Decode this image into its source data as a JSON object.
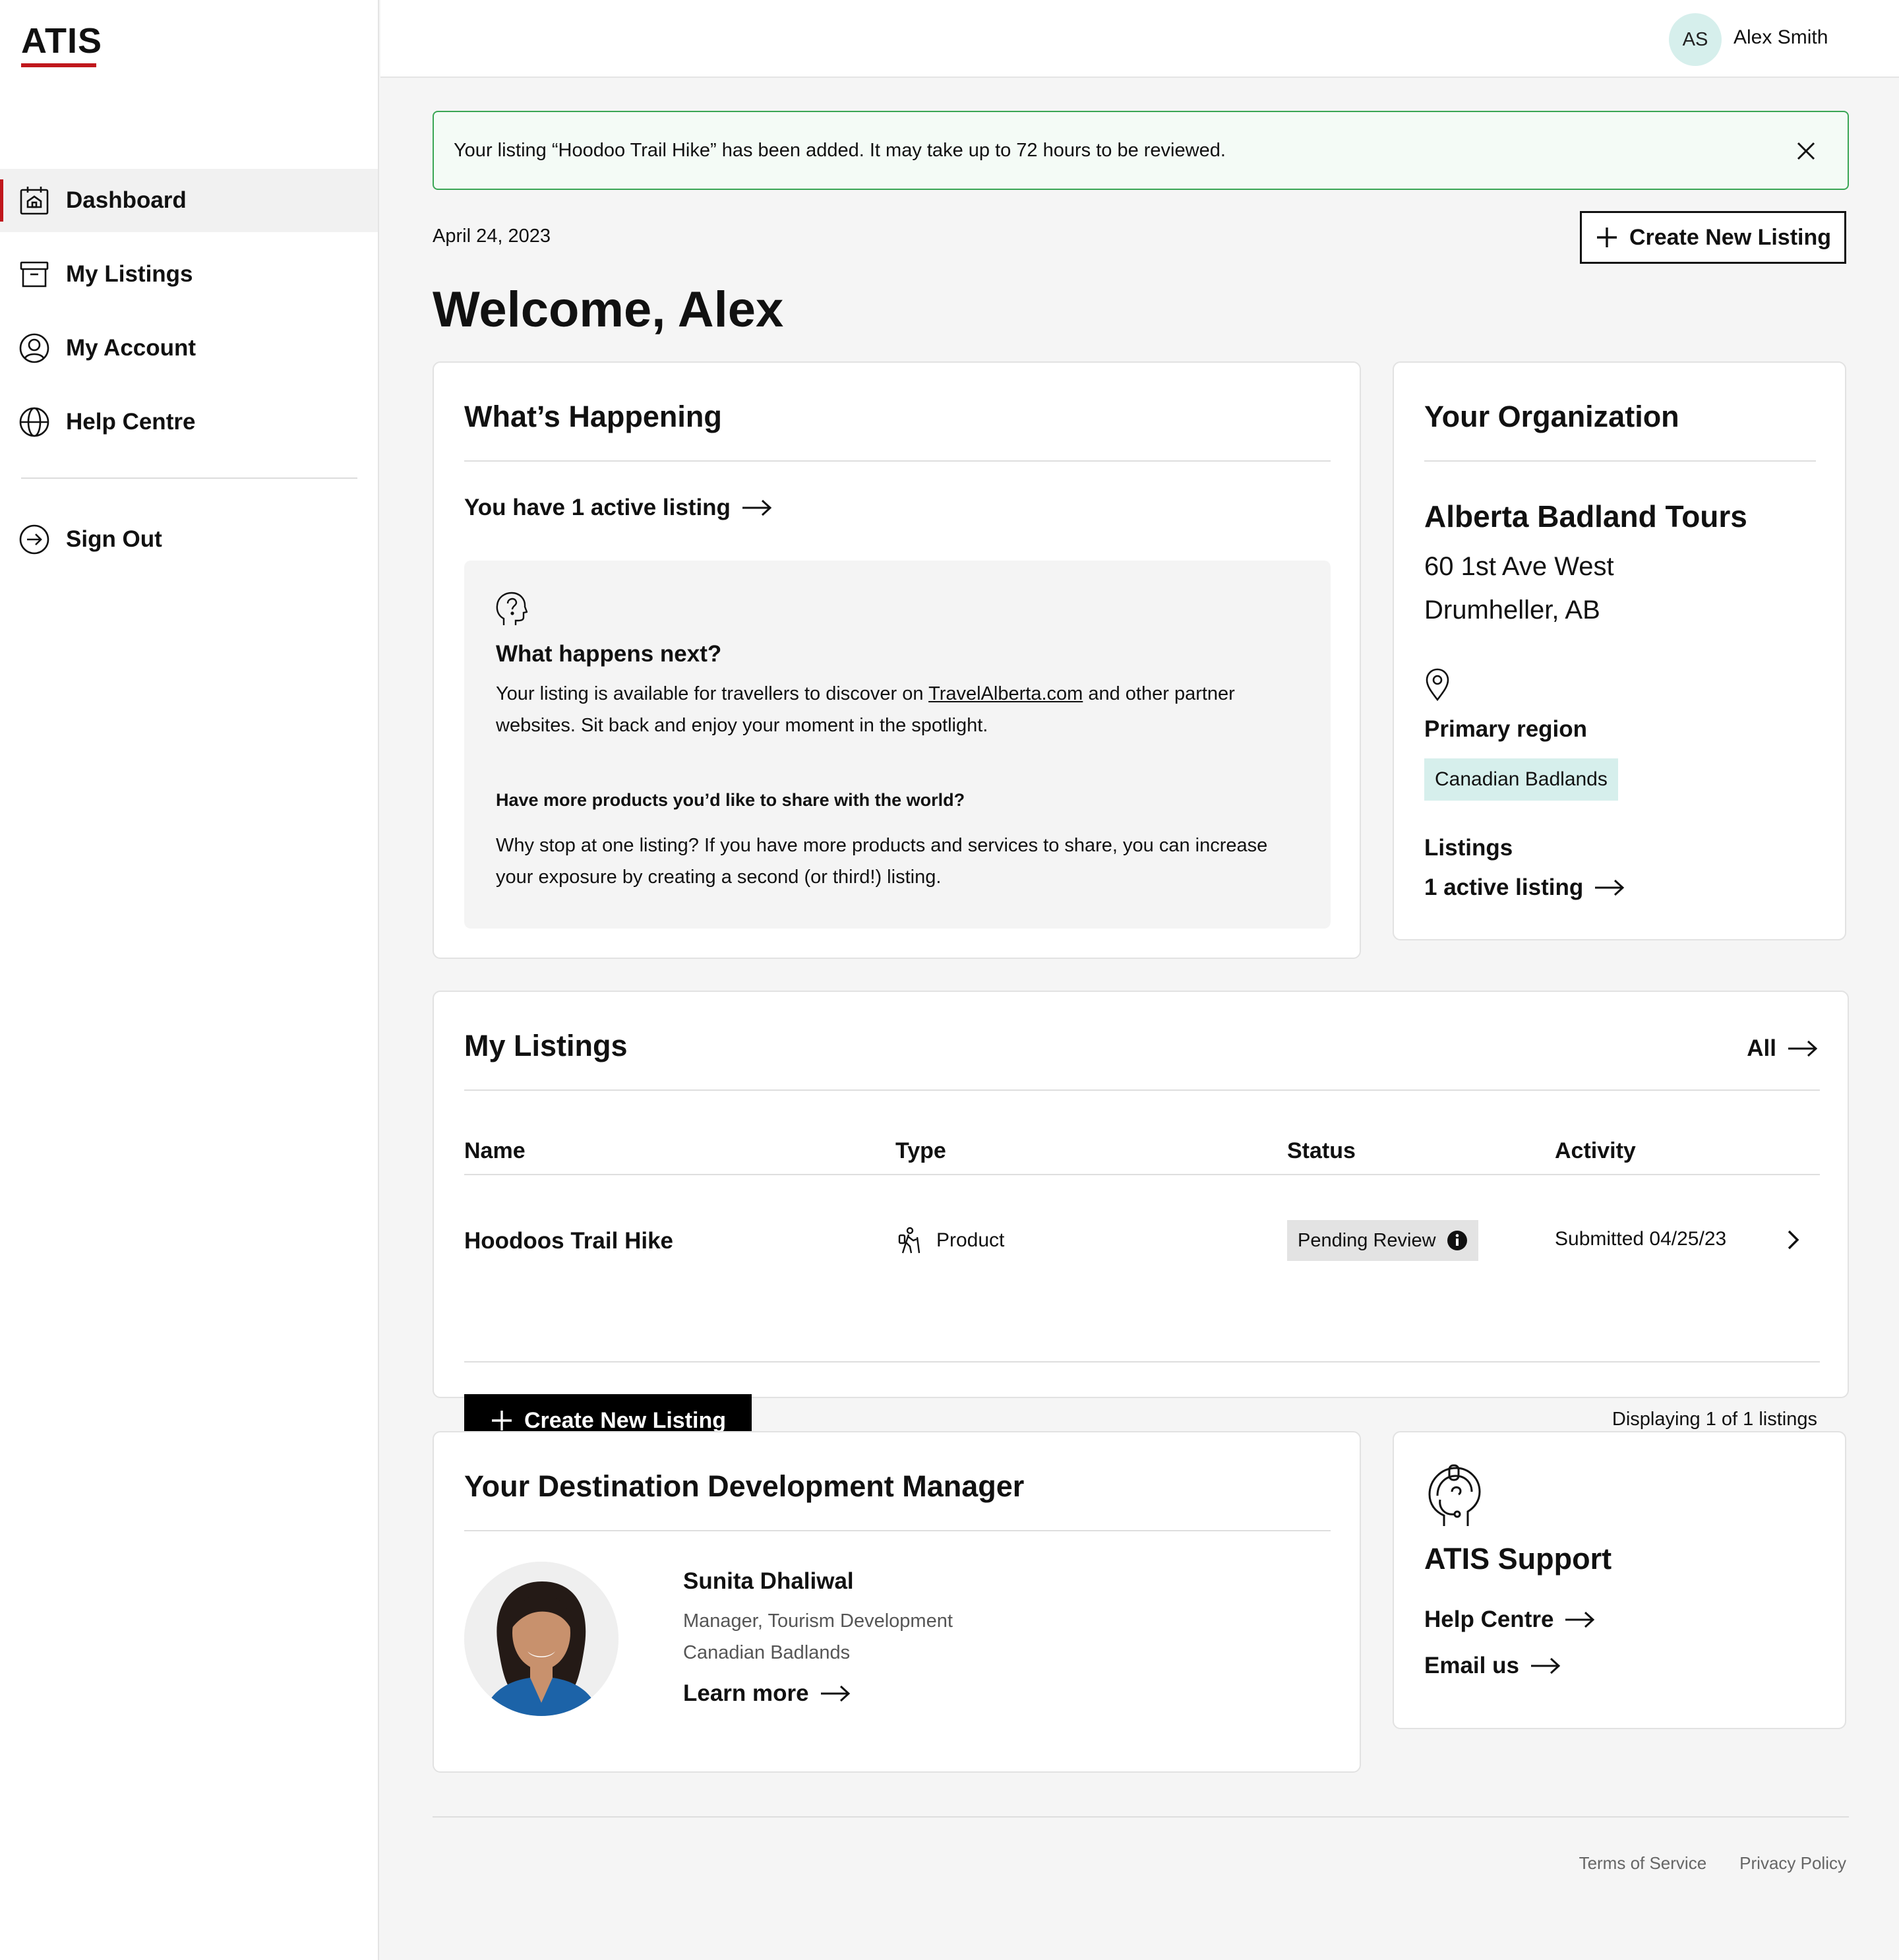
{
  "brand": {
    "logo_text": "ATIS",
    "accent": "#c0171c"
  },
  "sidebar": {
    "items": [
      {
        "label": "Dashboard",
        "icon": "home-calendar-icon",
        "active": true
      },
      {
        "label": "My Listings",
        "icon": "archive-box-icon",
        "active": false
      },
      {
        "label": "My Account",
        "icon": "user-circle-icon",
        "active": false
      },
      {
        "label": "Help Centre",
        "icon": "globe-icon",
        "active": false
      }
    ],
    "sign_out": {
      "label": "Sign Out",
      "icon": "sign-out-icon"
    }
  },
  "header": {
    "avatar_initials": "AS",
    "user_name": "Alex Smith"
  },
  "alert": {
    "message": "Your listing “Hoodoo Trail Hike” has been added. It may take up to 72 hours to be reviewed.",
    "color": "#3aa655"
  },
  "main": {
    "date": "April 24, 2023",
    "create_listing_label": "Create New Listing",
    "welcome": "Welcome, Alex"
  },
  "happening": {
    "title": "What’s Happening",
    "active_link": "You have 1 active listing",
    "next_title": "What happens next?",
    "next_text_before": "Your listing is available for travellers to discover on ",
    "next_link": "TravelAlberta.com",
    "next_text_after": " and other partner websites. Sit back and enjoy your moment in the spotlight.",
    "more_title": "Have more products you’d like to share with the world?",
    "more_text": "Why stop at one listing? If you have more products and services to share, you can increase your exposure by creating a second (or third!) listing."
  },
  "organization": {
    "title": "Your Organization",
    "name": "Alberta Badland Tours",
    "address_line1": "60 1st Ave West",
    "address_line2": "Drumheller, AB",
    "region_label": "Primary region",
    "region": "Canadian Badlands",
    "listings_label": "Listings",
    "listings_link": "1 active listing"
  },
  "listings": {
    "title": "My Listings",
    "all_label": "All",
    "columns": [
      "Name",
      "Type",
      "Status",
      "Activity"
    ],
    "rows": [
      {
        "name": "Hoodoos Trail Hike",
        "type": "Product",
        "status": "Pending Review",
        "activity": "Submitted 04/25/23"
      }
    ],
    "create_label": "Create New Listing",
    "displaying": "Displaying 1 of 1 listings"
  },
  "manager": {
    "title": "Your Destination Development Manager",
    "name": "Sunita Dhaliwal",
    "role": "Manager, Tourism Development",
    "region": "Canadian Badlands",
    "learn_more": "Learn more"
  },
  "support": {
    "title": "ATIS Support",
    "help_link": "Help Centre",
    "email_link": "Email us"
  },
  "footer": {
    "terms": "Terms of Service",
    "privacy": "Privacy Policy"
  }
}
